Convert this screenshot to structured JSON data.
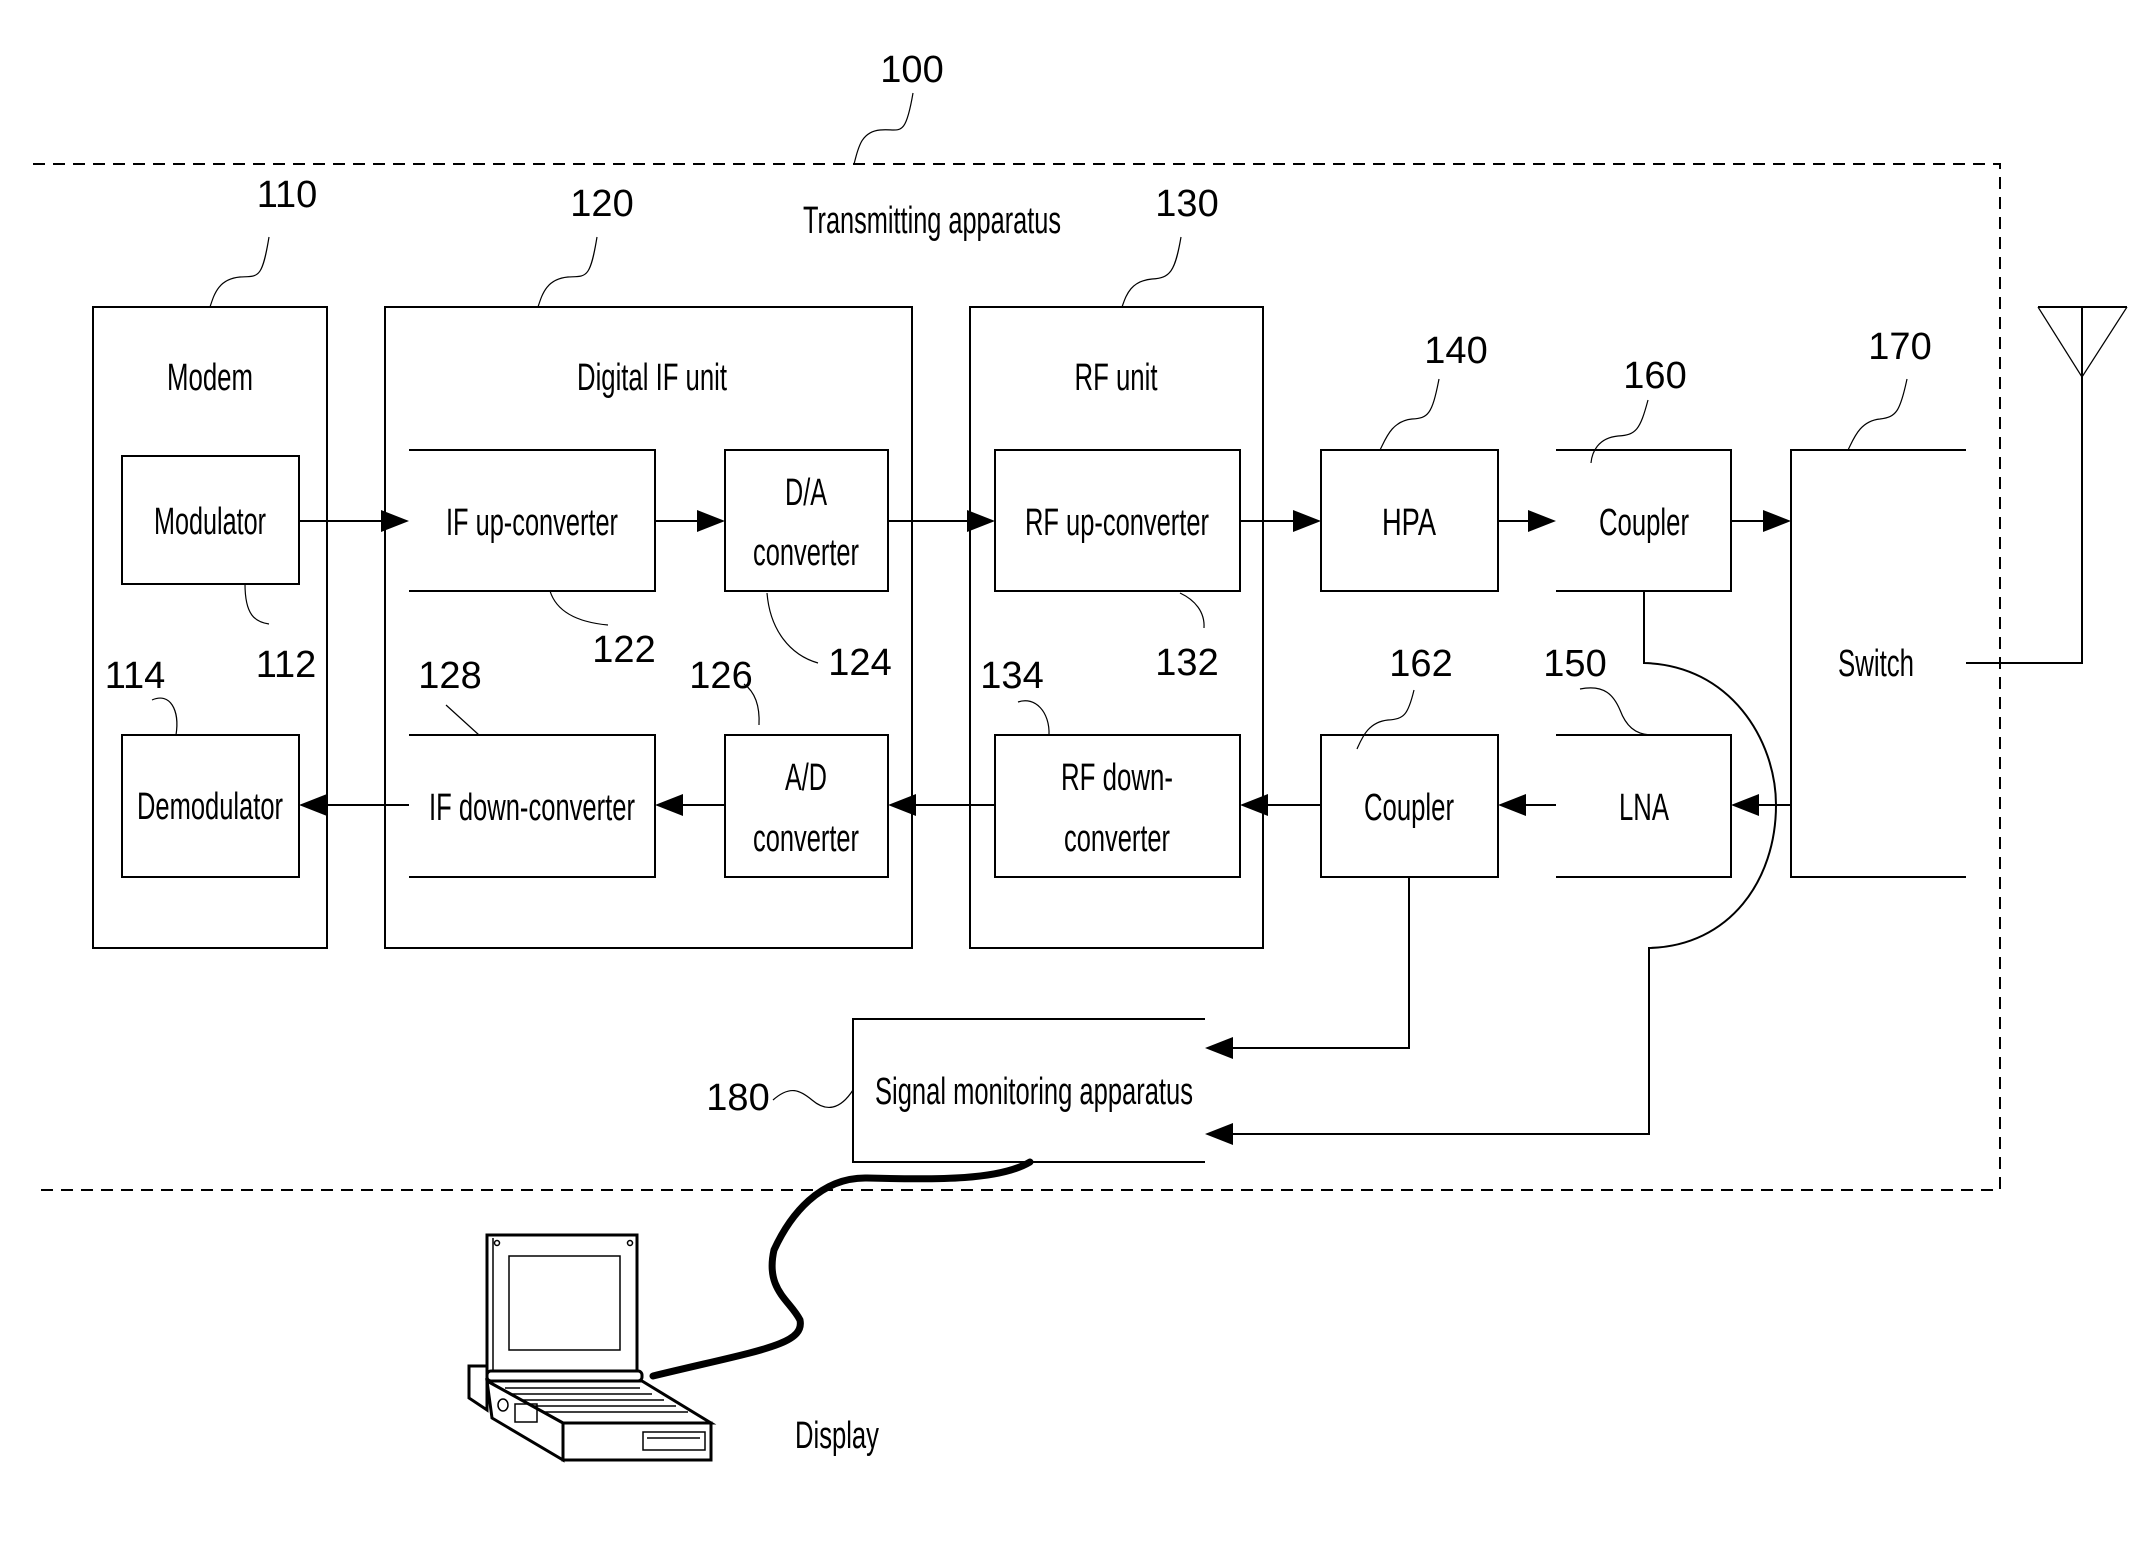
{
  "figure": {
    "system_ref": "100",
    "system_label": "Transmitting apparatus"
  },
  "blocks": {
    "modem": {
      "ref": "110",
      "label": "Modem"
    },
    "modulator": {
      "ref": "112",
      "label": "Modulator"
    },
    "demodulator": {
      "ref": "114",
      "label": "Demodulator"
    },
    "digital_if_unit": {
      "ref": "120",
      "label": "Digital IF unit"
    },
    "if_up_converter": {
      "ref": "122",
      "label": "IF up-converter"
    },
    "da_converter": {
      "ref": "124",
      "label_line1": "D/A",
      "label_line2": "converter"
    },
    "ad_converter": {
      "ref": "126",
      "label_line1": "A/D",
      "label_line2": "converter"
    },
    "if_down_converter": {
      "ref": "128",
      "label": "IF down-converter"
    },
    "rf_unit": {
      "ref": "130",
      "label": "RF unit"
    },
    "rf_up_converter": {
      "ref": "132",
      "label": "RF up-converter"
    },
    "rf_down_converter": {
      "ref": "134",
      "label_line1": "RF down-",
      "label_line2": "converter"
    },
    "hpa": {
      "ref": "140",
      "label": "HPA"
    },
    "lna": {
      "ref": "150",
      "label": "LNA"
    },
    "coupler_tx": {
      "ref": "160",
      "label": "Coupler"
    },
    "coupler_rx": {
      "ref": "162",
      "label": "Coupler"
    },
    "switch": {
      "ref": "170",
      "label": "Switch"
    },
    "signal_monitoring": {
      "ref": "180",
      "label": "Signal monitoring apparatus"
    }
  },
  "external": {
    "display_label": "Display",
    "display_icon": "laptop-icon",
    "antenna_icon": "antenna-icon"
  }
}
